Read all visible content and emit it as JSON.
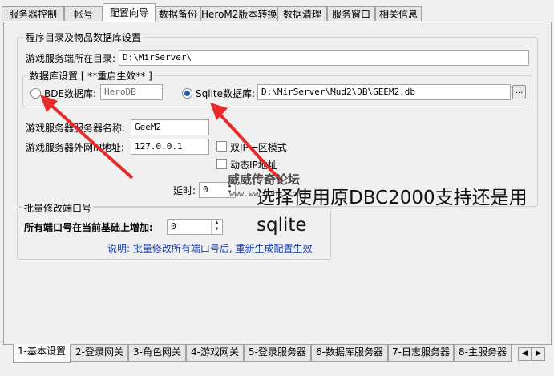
{
  "top_tabs": [
    {
      "label": "服务器控制"
    },
    {
      "label": "帐号"
    },
    {
      "label": "配置向导"
    },
    {
      "label": "数据备份"
    },
    {
      "label": "HeroM2版本转换"
    },
    {
      "label": "数据清理"
    },
    {
      "label": "服务窗口"
    },
    {
      "label": "相关信息"
    }
  ],
  "program_group": {
    "title": "程序目录及物品数据库设置",
    "game_dir_label": "游戏服务端所在目录:",
    "game_dir_value": "D:\\MirServer\\"
  },
  "db_group": {
    "title": "数据库设置 [ **重启生效** ]",
    "bde_label": "BDE数据库:",
    "bde_value": "HeroDB",
    "sqlite_label": "Sqlite数据库:",
    "sqlite_value": "D:\\MirServer\\Mud2\\DB\\GEEM2.db",
    "browse_label": "..."
  },
  "server": {
    "name_label": "游戏服务器服务器名称:",
    "name_value": "GeeM2",
    "ip_label": "游戏服务器外网IP地址:",
    "ip_value": "127.0.0.1",
    "dual_ip_label": "双IP一区模式",
    "dynamic_ip_label": "动态IP地址",
    "delay_label": "延时:",
    "delay_value": "0"
  },
  "port_group": {
    "title": "批量修改端口号",
    "increase_label": "所有端口号在当前基础上增加:",
    "increase_value": "0",
    "note": "说明: 批量修改所有端口号后, 重新生成配置生效"
  },
  "annotation": {
    "text": "选择使用原DBC2000支持还是用sqlite",
    "watermark": "威威传奇论坛",
    "watermark_url": "www.wwcqbbs.com"
  },
  "bottom_tabs": [
    {
      "label": "1-基本设置"
    },
    {
      "label": "2-登录网关"
    },
    {
      "label": "3-角色网关"
    },
    {
      "label": "4-游戏网关"
    },
    {
      "label": "5-登录服务器"
    },
    {
      "label": "6-数据库服务器"
    },
    {
      "label": "7-日志服务器"
    },
    {
      "label": "8-主服务器"
    }
  ],
  "colors": {
    "arrow": "#e82a2a",
    "note_text": "#1b3fa8",
    "radio_selected": "#1f5fbf"
  }
}
